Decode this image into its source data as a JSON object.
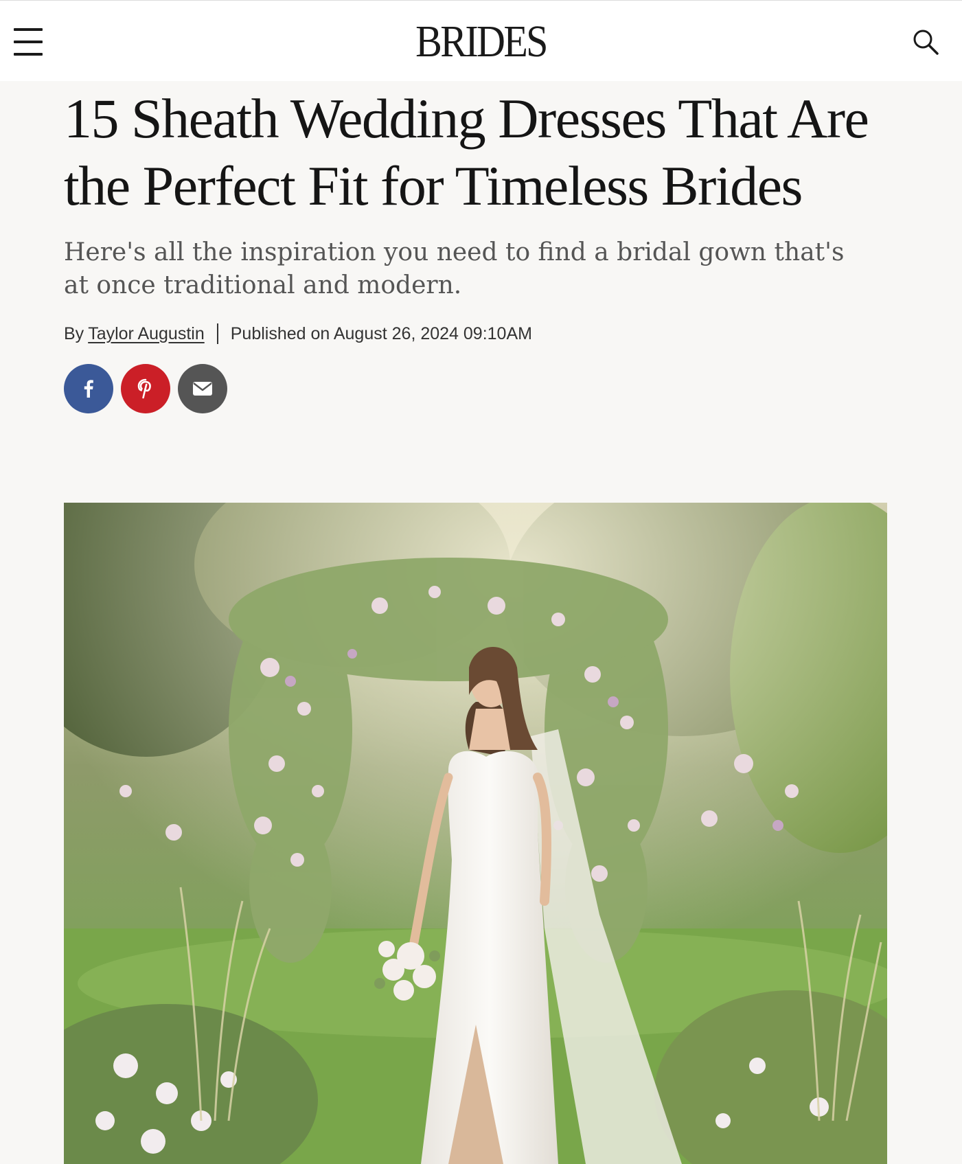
{
  "header": {
    "logo": "BRIDES",
    "menu_icon": "hamburger-menu-icon",
    "search_icon": "search-icon"
  },
  "article": {
    "title": "15 Sheath Wedding Dresses That Are the Perfect Fit for Timeless Brides",
    "subtitle": "Here's all the inspiration you need to find a bridal gown that's at once traditional and modern.",
    "byline_prefix": "By",
    "author": "Taylor Augustin",
    "published": "Published on August 26, 2024 09:10AM"
  },
  "social": [
    {
      "name": "facebook-icon",
      "color": "#3b5998"
    },
    {
      "name": "pinterest-icon",
      "color": "#cb1f27"
    },
    {
      "name": "email-icon",
      "color": "#555555"
    }
  ]
}
